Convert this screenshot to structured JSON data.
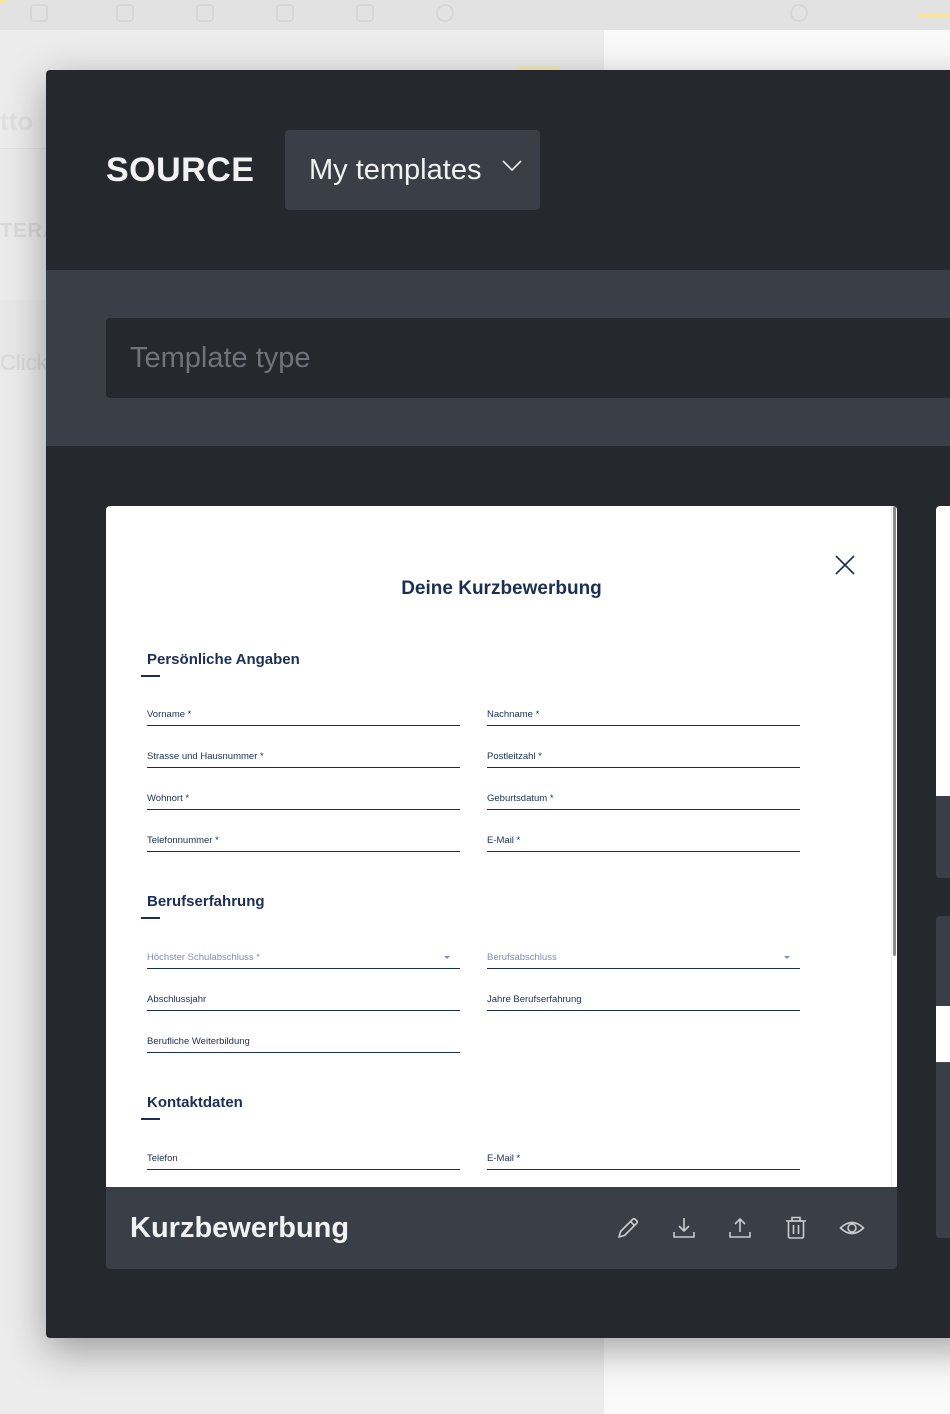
{
  "background_app": {
    "title_fragment": "tto",
    "section_fragment": "TERA",
    "click_fragment": "Click"
  },
  "modal": {
    "source_label": "SOURCE",
    "source_select": {
      "selected": "My templates"
    },
    "template_type_placeholder": "Template type"
  },
  "templates": [
    {
      "name": "Kurzbewerbung",
      "preview": {
        "title": "Deine Kurzbewerbung",
        "sections": [
          {
            "heading": "Persönliche Angaben",
            "fields": [
              {
                "label": "Vorname *"
              },
              {
                "label": "Nachname *"
              },
              {
                "label": "Strasse und Hausnummer *"
              },
              {
                "label": "Postleitzahl  *"
              },
              {
                "label": "Wohnort *"
              },
              {
                "label": "Geburtsdatum *"
              },
              {
                "label": "Telefonnummer *"
              },
              {
                "label": "E-Mail *"
              }
            ]
          },
          {
            "heading": "Berufserfahrung",
            "fields": [
              {
                "label": "Höchster Schulabschluss *",
                "type": "select"
              },
              {
                "label": "Berufsabschluss",
                "type": "select"
              },
              {
                "label": "Abschlussjahr"
              },
              {
                "label": "Jahre Berufserfahrung"
              },
              {
                "label": "Berufliche Weiterbildung"
              }
            ]
          },
          {
            "heading": "Kontaktdaten",
            "fields": [
              {
                "label": "Telefon"
              },
              {
                "label": "E-Mail *"
              }
            ]
          }
        ]
      },
      "actions": [
        "edit-icon",
        "download-icon",
        "upload-icon",
        "delete-icon",
        "preview-icon"
      ]
    }
  ],
  "colors": {
    "modal_bg": "#25282d",
    "panel_bg": "#393e47",
    "text_light": "#f2f2f2",
    "form_navy": "#1b2f55"
  }
}
